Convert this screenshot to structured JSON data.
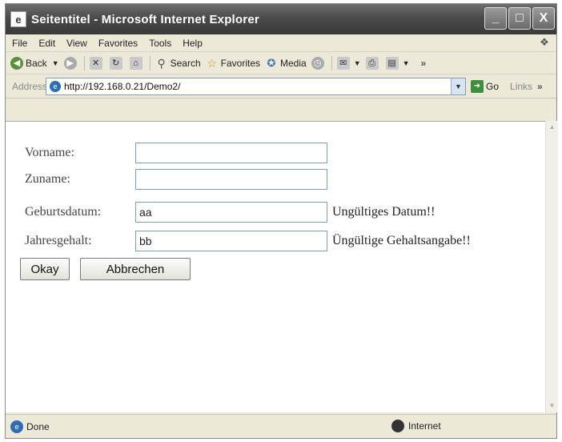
{
  "window": {
    "title": "Seitentitel - Microsoft Internet Explorer",
    "controls": {
      "minimize": "_",
      "maximize": "□",
      "close": "X"
    }
  },
  "menu": [
    "File",
    "Edit",
    "View",
    "Favorites",
    "Tools",
    "Help"
  ],
  "toolbar": {
    "back": "Back",
    "search": "Search",
    "favorites": "Favorites",
    "media": "Media"
  },
  "address": {
    "label": "Address",
    "url": "http://192.168.0.21/Demo2/",
    "go": "Go",
    "links": "Links"
  },
  "form": {
    "fields": [
      {
        "label": "Vorname:",
        "value": "",
        "error": ""
      },
      {
        "label": "Zuname:",
        "value": "",
        "error": ""
      },
      {
        "label": "Geburtsdatum:",
        "value": "aa",
        "error": "Ungültiges Datum!!"
      },
      {
        "label": "Jahresgehalt:",
        "value": "bb",
        "error": "Üngültige Gehaltsangabe!!"
      }
    ],
    "okay_label": "Okay",
    "cancel_label": "Abbrechen"
  },
  "status": {
    "text": "Done",
    "zone": "Internet"
  },
  "icons": [
    "ie-app-icon",
    "windows-logo-icon",
    "back-icon",
    "forward-icon",
    "stop-icon",
    "refresh-icon",
    "home-icon",
    "search-icon",
    "favorites-star-icon",
    "media-icon",
    "history-icon",
    "mail-icon",
    "print-icon",
    "page-icon",
    "go-arrow-icon",
    "internet-globe-icon"
  ],
  "colors": {
    "titlebar": "#4a4a4a",
    "chrome": "#ece9d8",
    "input_border": "#7f9db9"
  }
}
